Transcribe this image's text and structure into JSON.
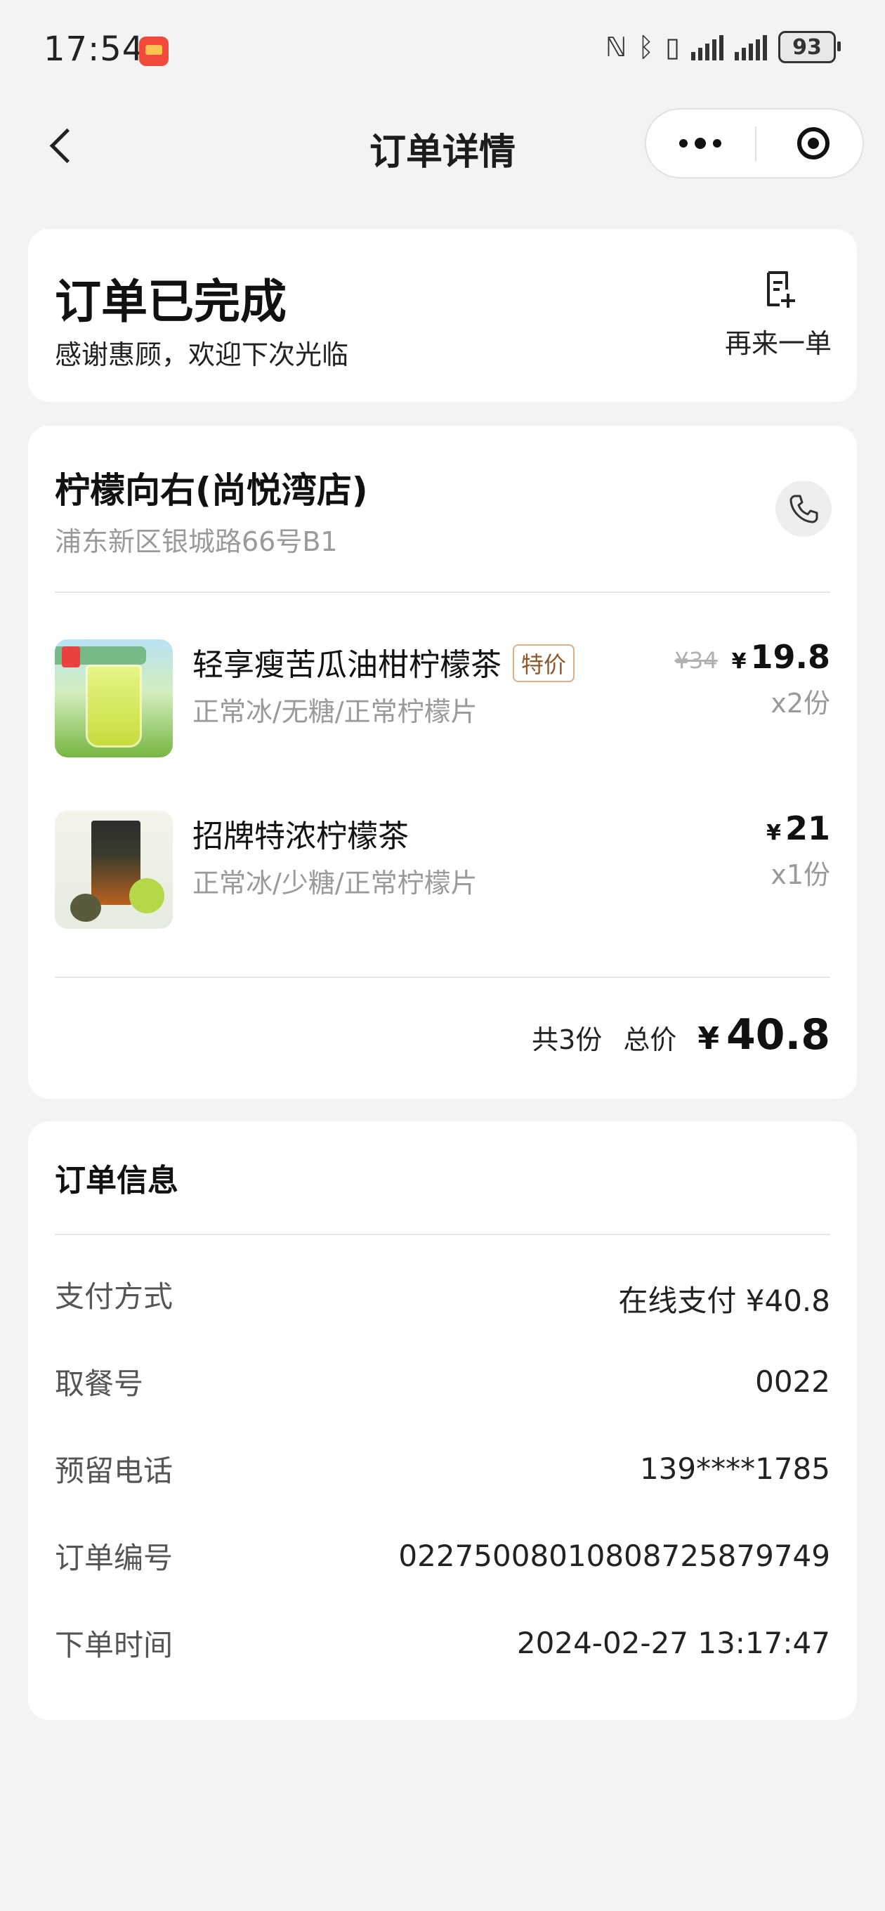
{
  "status_bar": {
    "time": "17:54",
    "icons": [
      "nfc-icon",
      "bluetooth-icon",
      "vibrate-icon",
      "signal-icon",
      "signal-icon"
    ],
    "battery": "93"
  },
  "nav": {
    "title": "订单详情"
  },
  "order_status": {
    "title": "订单已完成",
    "subtitle": "感谢惠顾，欢迎下次光临",
    "reorder_label": "再来一单"
  },
  "store": {
    "name": "柠檬向右(尚悦湾店)",
    "address": "浦东新区银城路66号B1"
  },
  "items": [
    {
      "name": "轻享瘦苦瓜油柑柠檬茶",
      "badge": "特价",
      "spec": "正常冰/无糖/正常柠檬片",
      "original_price": "¥34",
      "currency": "¥",
      "price": "19.8",
      "quantity": "x2份"
    },
    {
      "name": "招牌特浓柠檬茶",
      "spec": "正常冰/少糖/正常柠檬片",
      "currency": "¥",
      "price": "21",
      "quantity": "x1份"
    }
  ],
  "summary": {
    "count": "共3份",
    "total_label": "总价",
    "currency": "¥",
    "total": "40.8"
  },
  "order_info": {
    "title": "订单信息",
    "rows": [
      {
        "label": "支付方式",
        "value": "在线支付 ¥40.8"
      },
      {
        "label": "取餐号",
        "value": "0022"
      },
      {
        "label": "预留电话",
        "value": "139****1785"
      },
      {
        "label": "订单编号",
        "value": "02275008010808725879749"
      },
      {
        "label": "下单时间",
        "value": "2024-02-27 13:17:47"
      }
    ]
  }
}
